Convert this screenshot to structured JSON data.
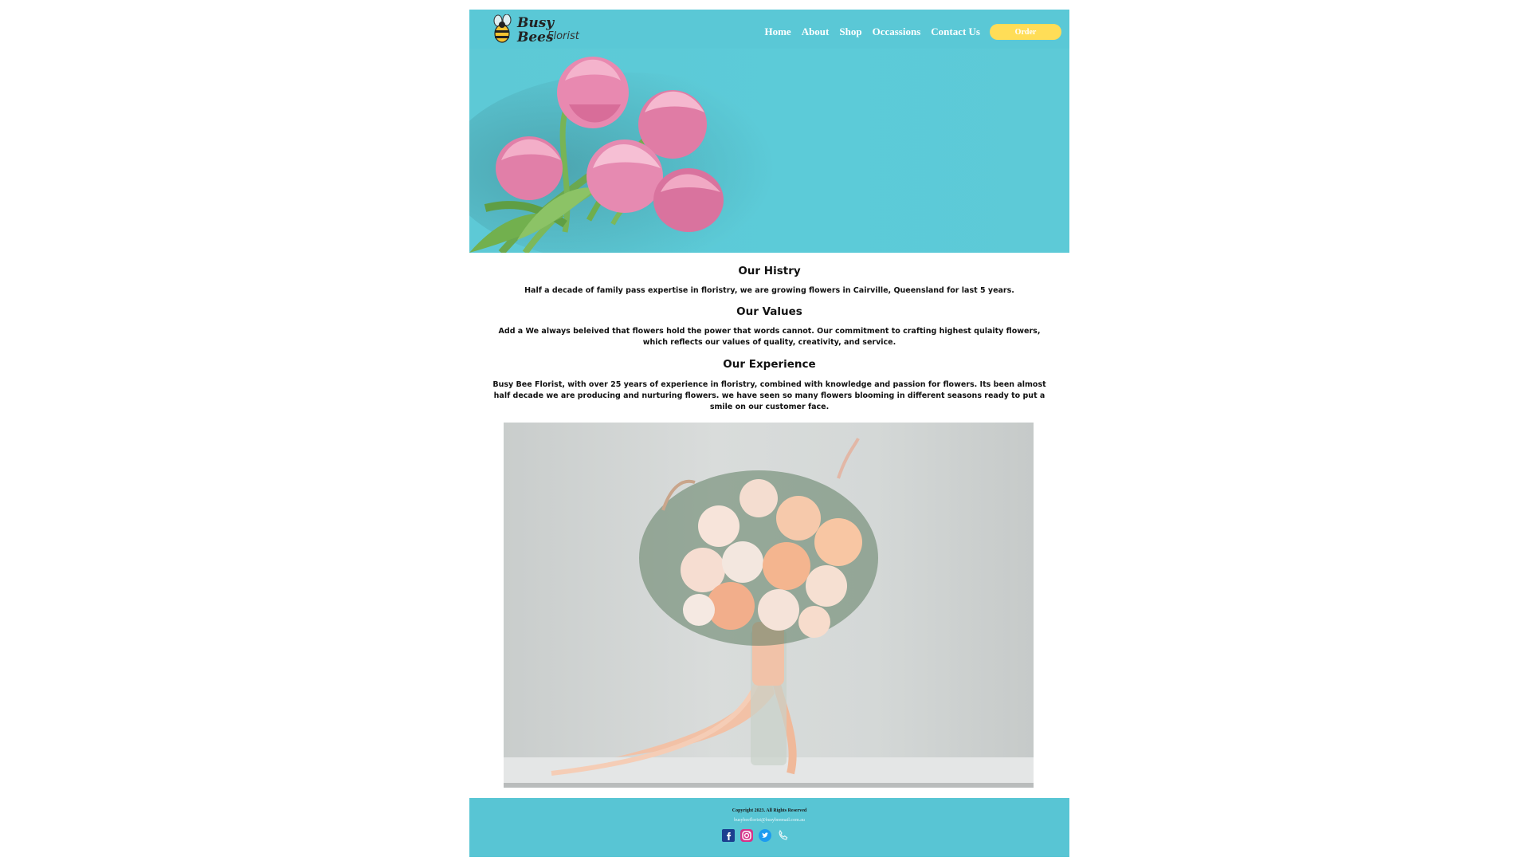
{
  "header": {
    "logo_title": "Busy Bees",
    "logo_subtitle": "Florist",
    "nav": [
      "Home",
      "About",
      "Shop",
      "Occassions",
      "Contact Us"
    ],
    "order_label": "Order"
  },
  "sections": [
    {
      "title": "Our Histry",
      "text": "Half a decade of family pass expertise in floristry, we are growing flowers in Cairville, Queensland for last 5 years."
    },
    {
      "title": "Our Values",
      "text": "Add a We always beleived that flowers hold the power that words cannot. Our commitment to crafting highest qulaity flowers, which reflects our values of quality, creativity, and service."
    },
    {
      "title": "Our Experience",
      "text": "Busy Bee Florist, with over 25 years of experience in floristry, combined with knowledge and passion for flowers. Its been almost half decade we are producing and nurturing flowers. we have seen so many flowers blooming in different seasons ready to put a smile on our customer face."
    }
  ],
  "footer": {
    "copyright": "Copyright 2023. All Rights Reserved",
    "email": "busybeeflorist@busybeemail.com.au",
    "social_icons": [
      "facebook-icon",
      "instagram-icon",
      "twitter-icon",
      "phone-icon"
    ]
  },
  "colors": {
    "brand_teal": "#5ac8d6",
    "order_yellow": "#ffdd57"
  }
}
